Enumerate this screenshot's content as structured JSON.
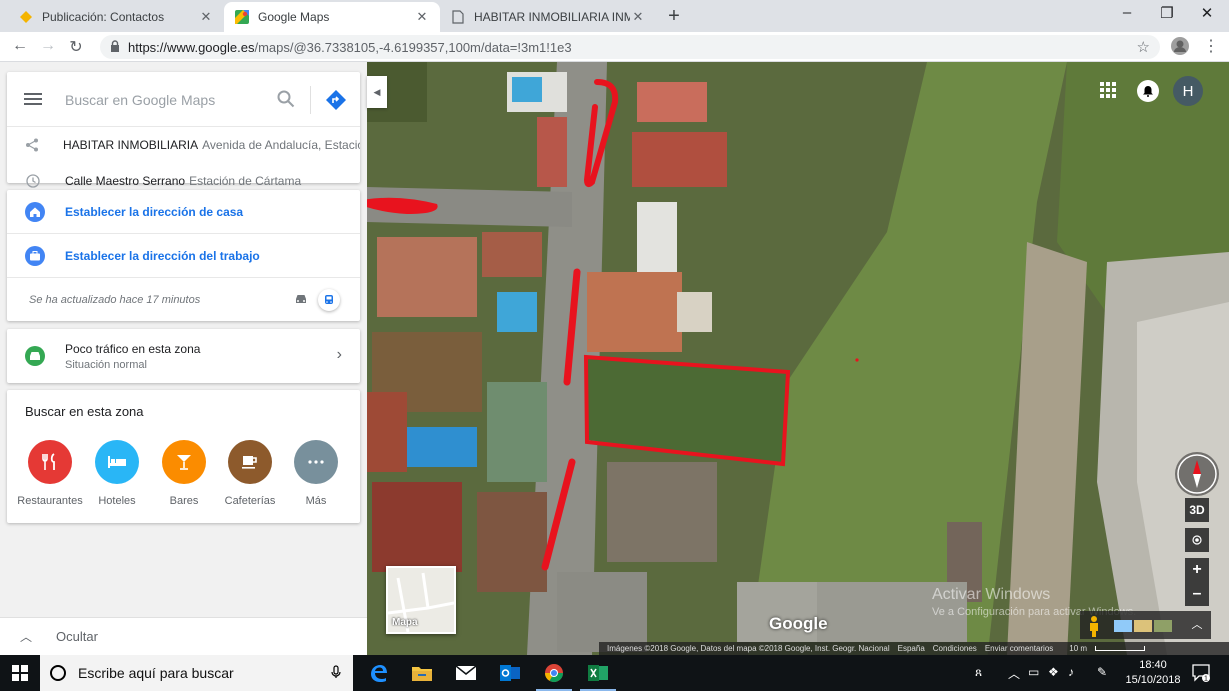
{
  "browser": {
    "tabs": [
      {
        "title": "Publicación: Contactos",
        "favicon": "diamond-icon"
      },
      {
        "title": "Google Maps",
        "favicon": "maps-icon"
      },
      {
        "title": "HABITAR INMOBILIARIA INMOBI",
        "favicon": "document-icon"
      }
    ],
    "active_tab": 1,
    "url_host": "https://www.google.es",
    "url_path": "/maps/@36.7338105,-4.6199357,100m/data=!3m1!1e3"
  },
  "sidebar": {
    "search_placeholder": "Buscar en Google Maps",
    "recent": [
      {
        "icon": "share-icon",
        "name": "HABITAR INMOBILIARIA",
        "detail": "Avenida de Andalucía, Estació…"
      },
      {
        "icon": "clock-icon",
        "name": "Calle Maestro Serrano",
        "detail": "Estación de Cártama"
      }
    ],
    "home_label": "Establecer la dirección de casa",
    "work_label": "Establecer la dirección del trabajo",
    "updated_text": "Se ha actualizado hace 17 minutos",
    "traffic": {
      "title": "Poco tráfico en esta zona",
      "subtitle": "Situación normal"
    },
    "nearby": {
      "title": "Buscar en esta zona",
      "categories": [
        {
          "label": "Restaurantes",
          "color": "#e53935",
          "icon": "fork-knife-icon"
        },
        {
          "label": "Hoteles",
          "color": "#29b6f6",
          "icon": "bed-icon"
        },
        {
          "label": "Bares",
          "color": "#fb8c00",
          "icon": "cocktail-icon"
        },
        {
          "label": "Cafeterías",
          "color": "#8d5a2c",
          "icon": "coffee-icon"
        },
        {
          "label": "Más",
          "color": "#78909c",
          "icon": "more-icon"
        }
      ]
    },
    "collapse_label": "Ocultar"
  },
  "map": {
    "avatar_letter": "H",
    "tilt_label": "3D",
    "layer_label": "Mapa",
    "logo": "Google",
    "watermark_title": "Activar Windows",
    "watermark_sub": "Ve a Configuración para activar Windows.",
    "attribution": "Imágenes ©2018 Google, Datos del mapa ©2018 Google, Inst. Geogr. Nacional",
    "links": [
      "España",
      "Condiciones",
      "Enviar comentarios"
    ],
    "scale": "10 m"
  },
  "taskbar": {
    "search_placeholder": "Escribe aquí para buscar",
    "time": "18:40",
    "date": "15/10/2018",
    "notifications": "1"
  }
}
